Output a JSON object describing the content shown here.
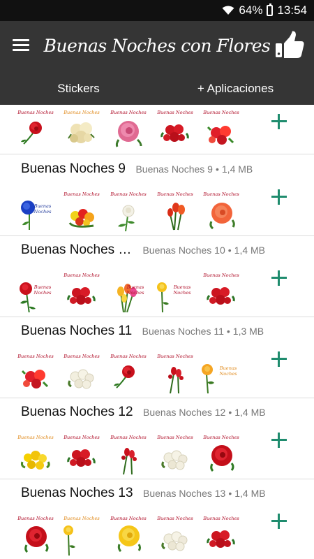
{
  "status_bar": {
    "battery": "64%",
    "time": "13:54"
  },
  "app_bar": {
    "title": "Buenas Noches con Flores",
    "menu_icon": "menu-icon",
    "like_icon": "thumbs-up-icon"
  },
  "tabs": [
    {
      "label": "Stickers"
    },
    {
      "label": "+ Aplicaciones"
    }
  ],
  "sticker_caption": "Buenas Noches",
  "packs": [
    {
      "name": "",
      "publisher": "",
      "size": ""
    },
    {
      "name": "Buenas Noches 9",
      "publisher": "Buenas Noches 9",
      "size": "1,4 MB"
    },
    {
      "name": "Buenas Noches 10",
      "publisher": "Buenas Noches 10",
      "size": "1,4 MB"
    },
    {
      "name": "Buenas Noches 11",
      "publisher": "Buenas Noches 11",
      "size": "1,3 MB"
    },
    {
      "name": "Buenas Noches 12",
      "publisher": "Buenas Noches 12",
      "size": "1,4 MB"
    },
    {
      "name": "Buenas Noches 13",
      "publisher": "Buenas Noches 13",
      "size": "1,4 MB"
    }
  ],
  "colors": {
    "accent_plus": "#1f8c6e",
    "app_bar": "#353535",
    "status_bar": "#111111"
  }
}
